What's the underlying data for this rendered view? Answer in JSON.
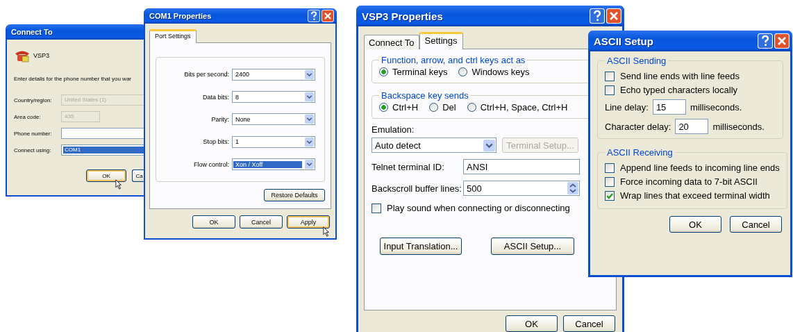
{
  "connect_to_dialog": {
    "title": "Connect To",
    "connection_name": "VSP3",
    "prompt": "Enter details for the phone number that you war",
    "fields": [
      {
        "label": "Country/region:",
        "value": "United States (1)",
        "disabled": true,
        "highlighted": false
      },
      {
        "label": "Area code:",
        "value": "435",
        "disabled": true,
        "highlighted": false
      },
      {
        "label": "Phone number:",
        "disabled": false,
        "highlighted": false
      },
      {
        "label": "Connect using:",
        "value": "COM1",
        "disabled": false,
        "highlighted": true
      }
    ],
    "buttons": [
      "OK",
      "Ca"
    ]
  },
  "com1_dialog": {
    "title": "COM1 Properties",
    "tabs": [
      {
        "label": "Port Settings",
        "selected": true
      }
    ],
    "fields": [
      {
        "label": "Bits per second:",
        "value": "2400",
        "highlighted": false
      },
      {
        "label": "Data bits:",
        "value": "8",
        "highlighted": false
      },
      {
        "label": "Parity:",
        "value": "None",
        "highlighted": false
      },
      {
        "label": "Stop bits:",
        "value": "1",
        "highlighted": false
      },
      {
        "label": "Flow control:",
        "value": "Xon / Xoff",
        "highlighted": true
      }
    ],
    "restore_button": "Restore Defaults",
    "buttons": [
      "OK",
      "Cancel",
      "Apply"
    ]
  },
  "vsp3_dialog": {
    "title": "VSP3 Properties",
    "tabs": [
      {
        "label": "Connect To",
        "selected": false
      },
      {
        "label": "Settings",
        "selected": true
      }
    ],
    "groups": [
      {
        "title": "Function, arrow, and ctrl keys act as",
        "options": [
          {
            "label": "Terminal keys",
            "selected": true
          },
          {
            "label": "Windows keys",
            "selected": false
          }
        ]
      },
      {
        "title": "Backspace key sends",
        "options": [
          {
            "label": "Ctrl+H",
            "selected": true
          },
          {
            "label": "Del",
            "selected": false
          },
          {
            "label": "Ctrl+H, Space, Ctrl+H",
            "selected": false
          }
        ]
      }
    ],
    "emulation": {
      "label": "Emulation:",
      "value": "Auto detect"
    },
    "terminal_setup": {
      "label": "Terminal Setup...",
      "disabled": true
    },
    "telnet_id": {
      "label": "Telnet terminal ID:",
      "value": "ANSI"
    },
    "backscroll": {
      "label": "Backscroll buffer lines:",
      "value": "500"
    },
    "play_sound": {
      "label": "Play sound when connecting or disconnecting",
      "checked": false
    },
    "action_buttons": [
      "Input Translation...",
      "ASCII Setup..."
    ],
    "buttons": [
      "OK",
      "Cancel"
    ]
  },
  "ascii_dialog": {
    "title": "ASCII Setup",
    "sending": {
      "title": "ASCII Sending",
      "checkboxes": [
        {
          "label": "Send line ends with line feeds",
          "checked": false
        },
        {
          "label": "Echo typed characters locally",
          "checked": false
        }
      ],
      "delays": [
        {
          "label": "Line delay:",
          "value": "15",
          "unit": "milliseconds."
        },
        {
          "label": "Character delay:",
          "value": "20",
          "unit": "milliseconds."
        }
      ]
    },
    "receiving": {
      "title": "ASCII Receiving",
      "checkboxes": [
        {
          "label": "Append line feeds to incoming line ends",
          "checked": false
        },
        {
          "label": "Force incoming data to 7-bit ASCII",
          "checked": false
        },
        {
          "label": "Wrap lines that exceed terminal width",
          "checked": true
        }
      ]
    },
    "buttons": [
      "OK",
      "Cancel"
    ]
  }
}
